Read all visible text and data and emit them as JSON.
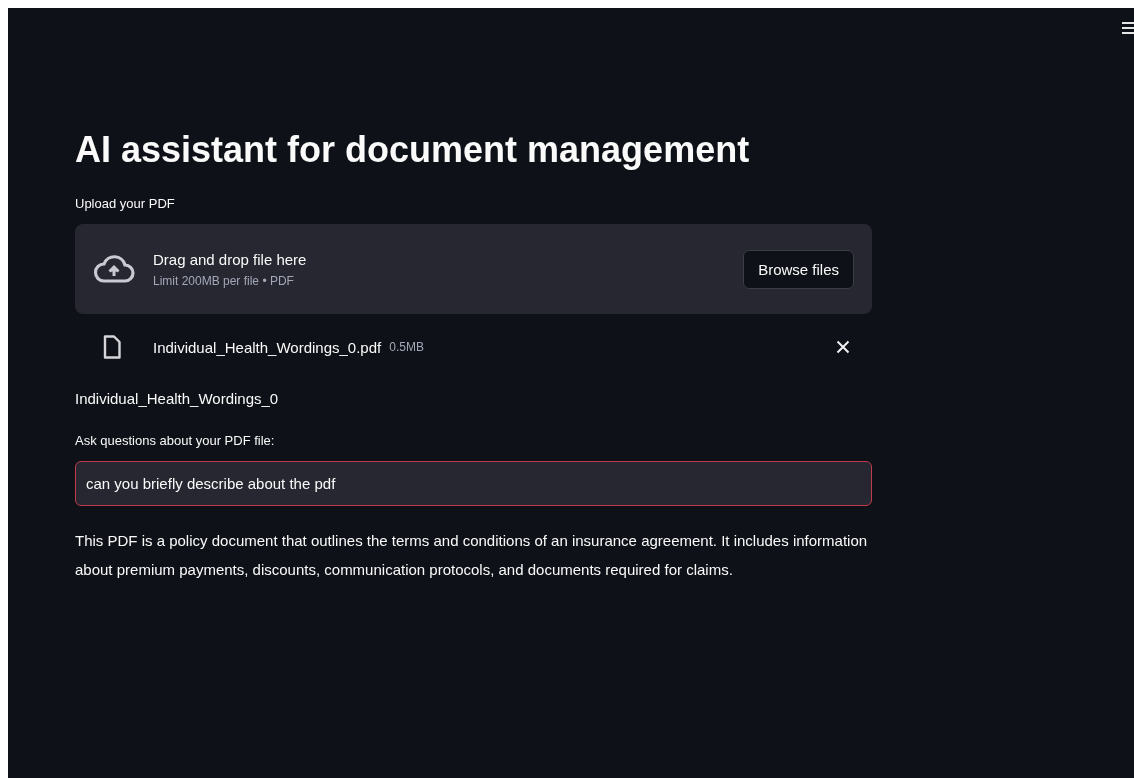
{
  "title": "AI assistant for document management",
  "uploader": {
    "label": "Upload your PDF",
    "drop_text": "Drag and drop file here",
    "limit_text": "Limit 200MB per file • PDF",
    "button": "Browse files"
  },
  "uploaded_file": {
    "name": "Individual_Health_Wordings_0.pdf",
    "size": "0.5MB"
  },
  "file_heading": "Individual_Health_Wordings_0",
  "question": {
    "label": "Ask questions about your PDF file:",
    "value": "can you briefly describe about the pdf",
    "focused": true
  },
  "answer": "This PDF is a policy document that outlines the terms and conditions of an insurance agreement. It includes information about premium payments, discounts, communication protocols, and documents required for claims."
}
